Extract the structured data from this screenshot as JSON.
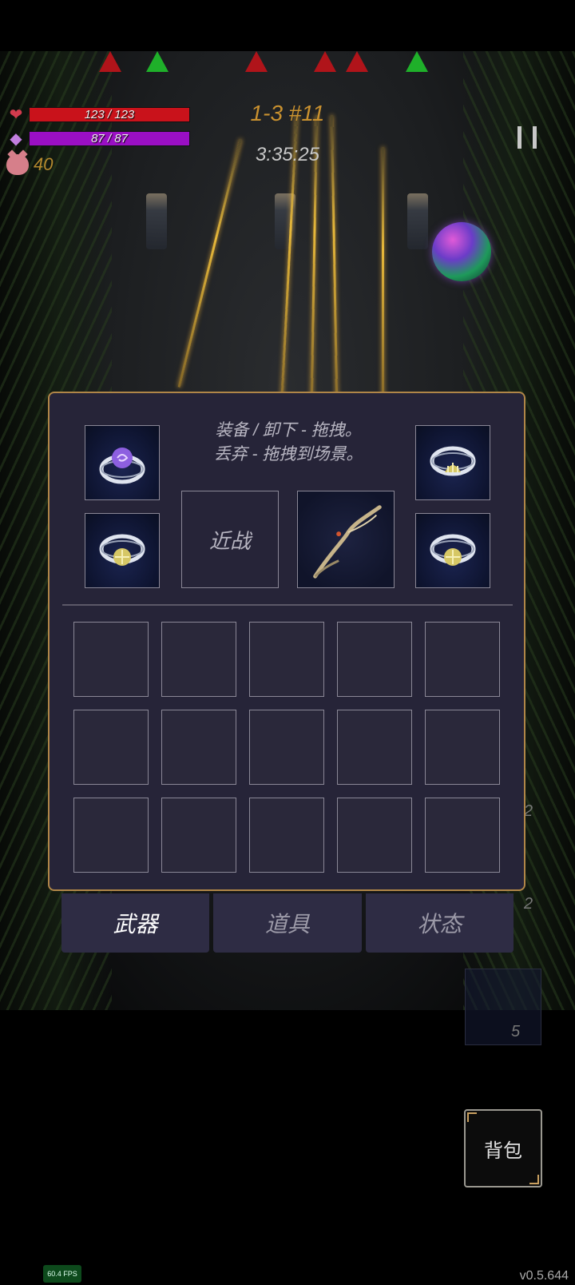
{
  "hud": {
    "hp_text": "123 / 123",
    "mp_text": "87 / 87",
    "coins": "40",
    "stage": "1-3 #11",
    "timer": "3:35:25"
  },
  "markers": [
    "red",
    "green",
    "red",
    "red",
    "red",
    "green"
  ],
  "panel": {
    "instructions_line1": "装备 / 卸下 - 拖拽。",
    "instructions_line2": "丢弃 - 拖拽到场景。",
    "melee_label": "近战",
    "inventory_rows": 3,
    "inventory_cols": 5
  },
  "tabs": [
    {
      "label": "武器",
      "active": true
    },
    {
      "label": "道具",
      "active": false
    },
    {
      "label": "状态",
      "active": false
    }
  ],
  "side_numbers": {
    "n1": "2",
    "n2": "2",
    "n3": "5"
  },
  "bag_label": "背包",
  "fps": "60.4 FPS",
  "version": "v0.5.644",
  "colors": {
    "hp": "#c9121b",
    "mp": "#9a0fc4",
    "panel_border": "#b08648",
    "stage": "#c9912f"
  }
}
